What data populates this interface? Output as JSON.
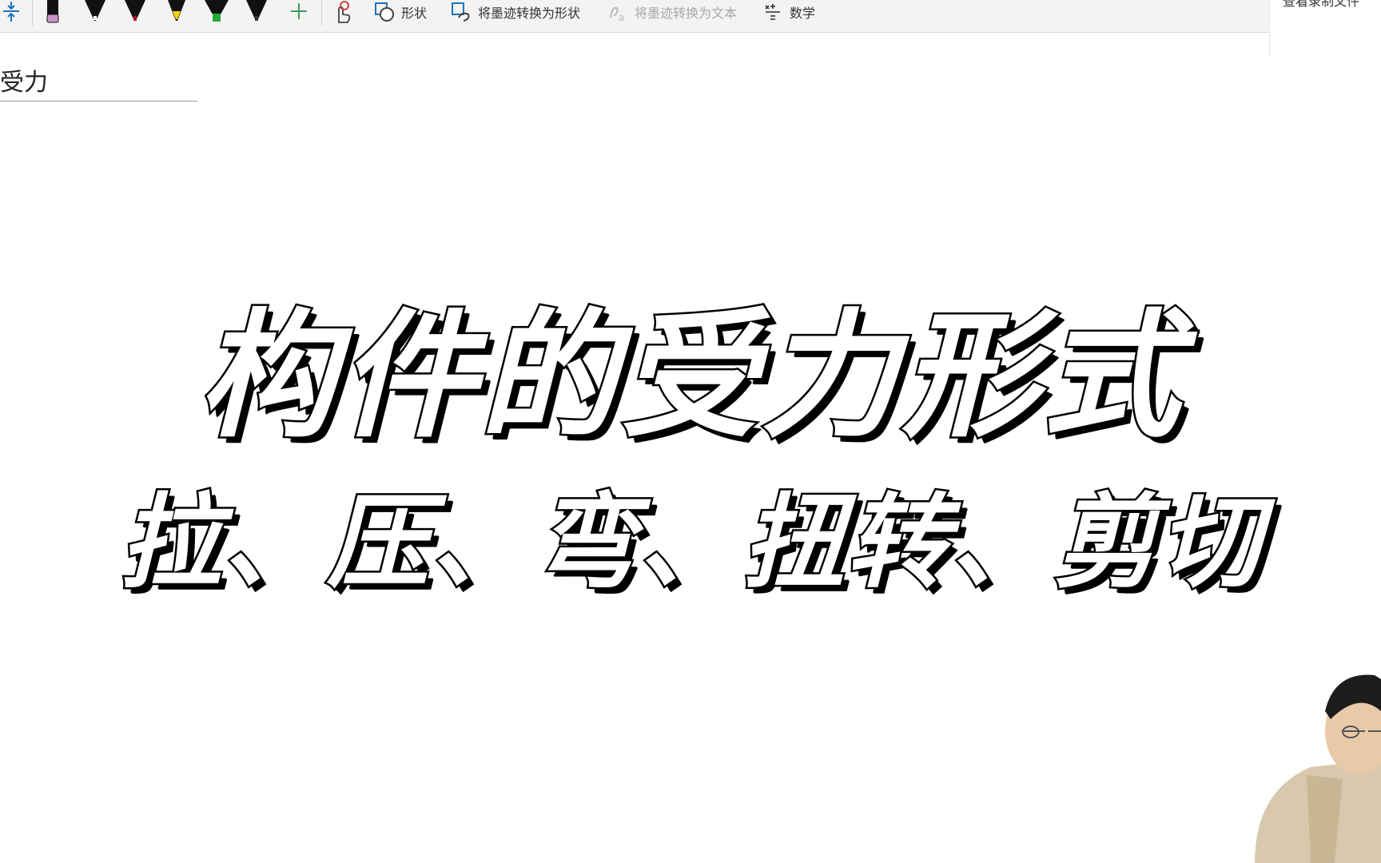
{
  "toolbar": {
    "tools": {
      "shape_label": "形状",
      "ink_to_shape_label": "将墨迹转换为形状",
      "ink_to_text_label": "将墨迹转换为文本",
      "math_label": "数学"
    },
    "pen_colors": [
      "#c892c8",
      "#ffffff",
      "#b01020",
      "#ffd200",
      "#1faa3a",
      "#333333"
    ]
  },
  "side_panel": {
    "label": "查看录制文件"
  },
  "note": {
    "title": "受力",
    "headline": "构件的受力形式",
    "subline": "拉、压、弯、扭转、剪切"
  },
  "colors": {
    "accent": "#1e73be",
    "text_fill": "#ffffff",
    "text_outline": "#000000"
  }
}
